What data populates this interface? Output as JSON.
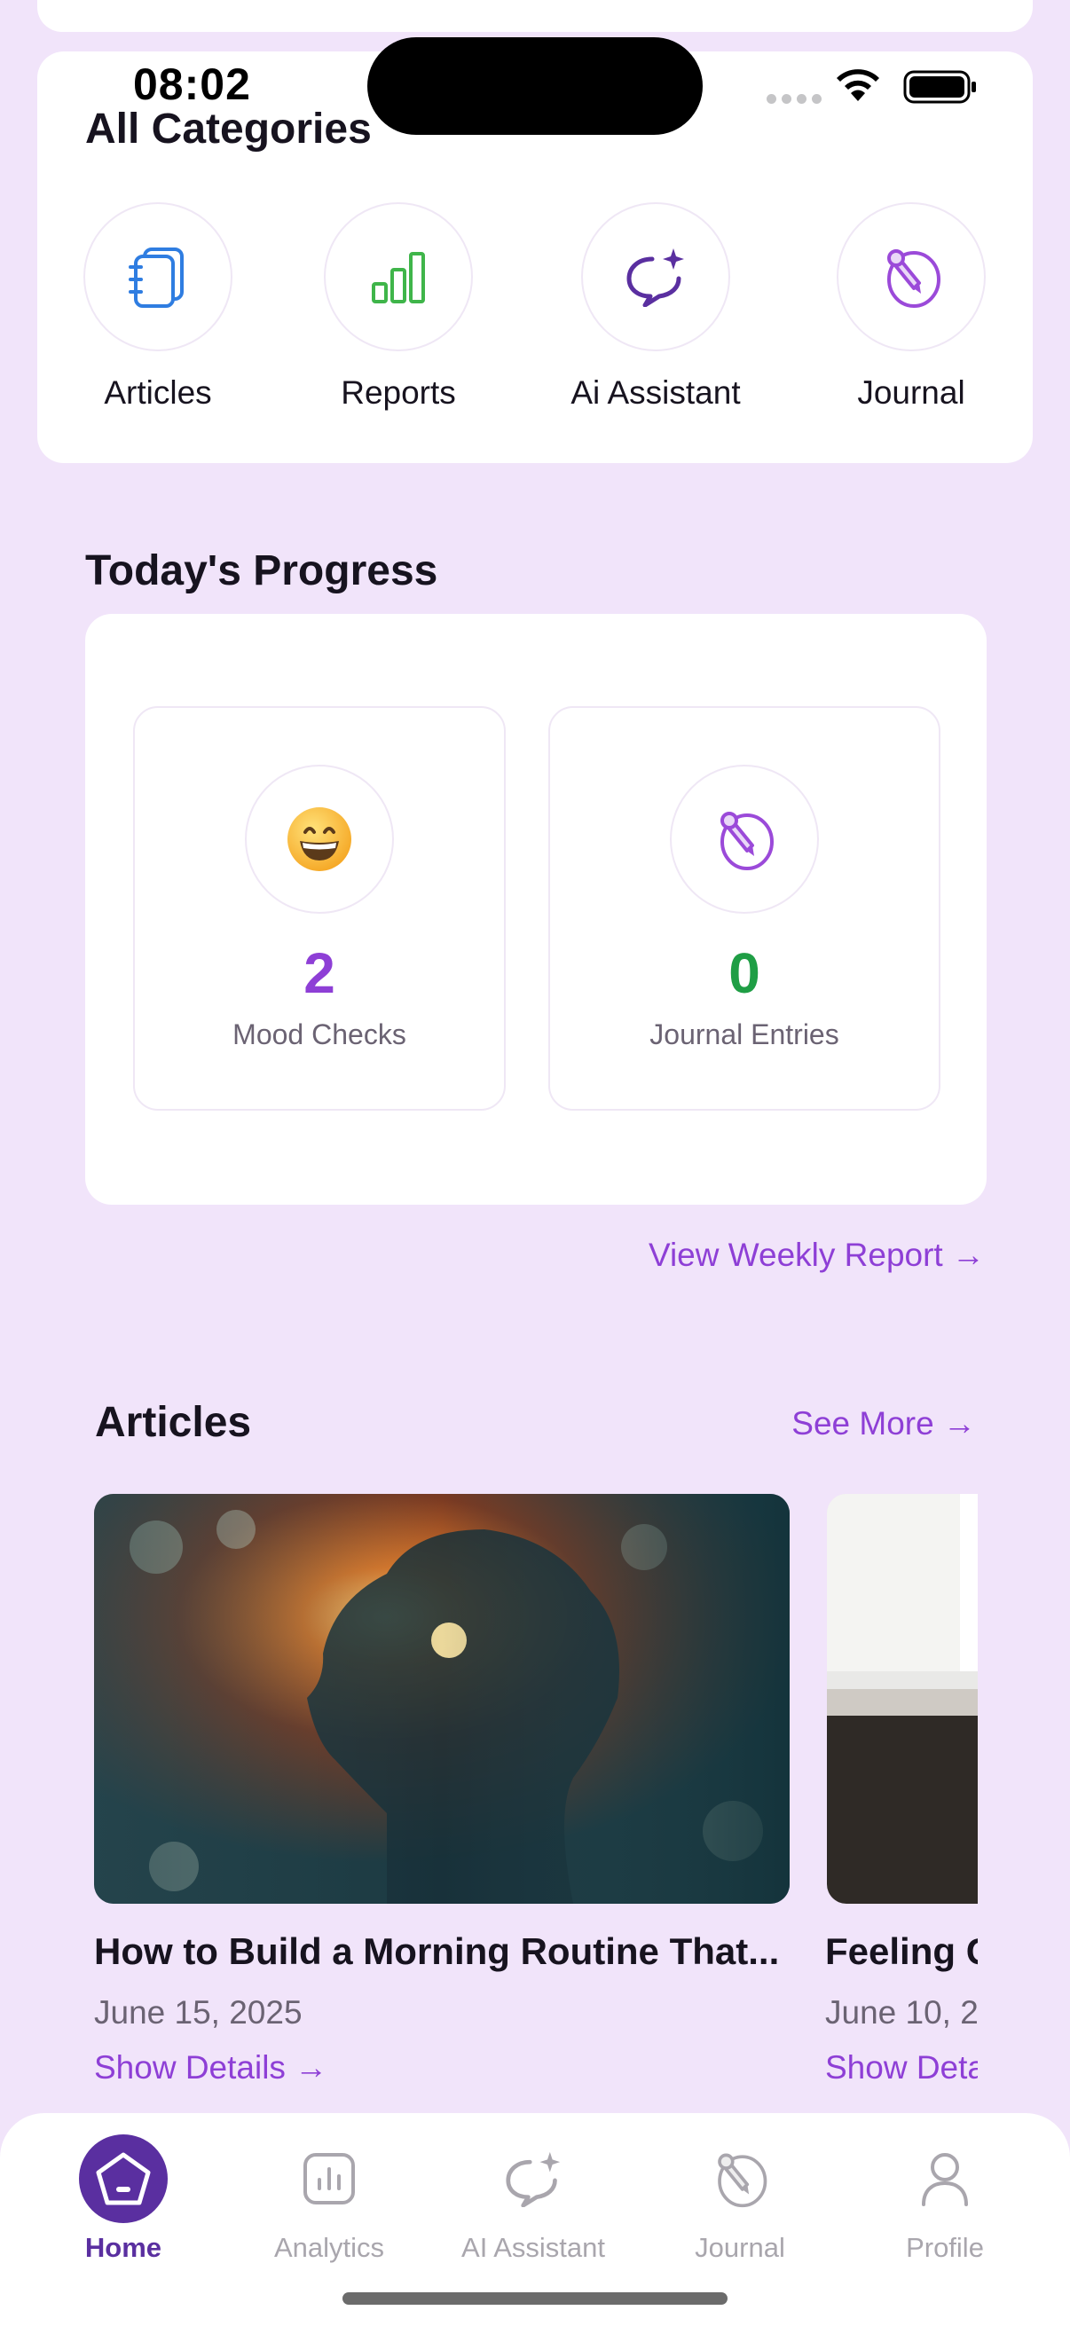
{
  "status_bar": {
    "time": "08:02"
  },
  "categories": {
    "title": "All Categories",
    "items": [
      {
        "label": "Articles",
        "icon": "notebook-icon",
        "color": "#2f7de1"
      },
      {
        "label": "Reports",
        "icon": "bar-chart-icon",
        "color": "#3fb54a"
      },
      {
        "label": "Ai Assistant",
        "icon": "chat-sparkle-icon",
        "color": "#5a2fa0"
      },
      {
        "label": "Journal",
        "icon": "journal-pen-icon",
        "color": "#9b4ad9"
      }
    ]
  },
  "progress": {
    "title": "Today's Progress",
    "stats": [
      {
        "value": "2",
        "label": "Mood Checks",
        "icon": "grinning-face-emoji",
        "color": "#8e3fd6"
      },
      {
        "value": "0",
        "label": "Journal Entries",
        "icon": "journal-pen-icon",
        "color": "#1f9e45"
      }
    ],
    "weekly_link": "View Weekly Report →"
  },
  "articles": {
    "title": "Articles",
    "see_more": "See More →",
    "items": [
      {
        "title": "How to Build a Morning Routine That...",
        "date": "June 15, 2025",
        "link": "Show Details →"
      },
      {
        "title": "Feeling C",
        "date": "June 10, 2",
        "link": "Show Deta"
      }
    ]
  },
  "tabbar": {
    "tabs": [
      {
        "label": "Home",
        "icon": "home-icon",
        "active": true
      },
      {
        "label": "Analytics",
        "icon": "analytics-icon",
        "active": false
      },
      {
        "label": "AI Assistant",
        "icon": "chat-sparkle-icon",
        "active": false
      },
      {
        "label": "Journal",
        "icon": "journal-pen-icon",
        "active": false
      },
      {
        "label": "Profile",
        "icon": "profile-icon",
        "active": false
      }
    ]
  }
}
